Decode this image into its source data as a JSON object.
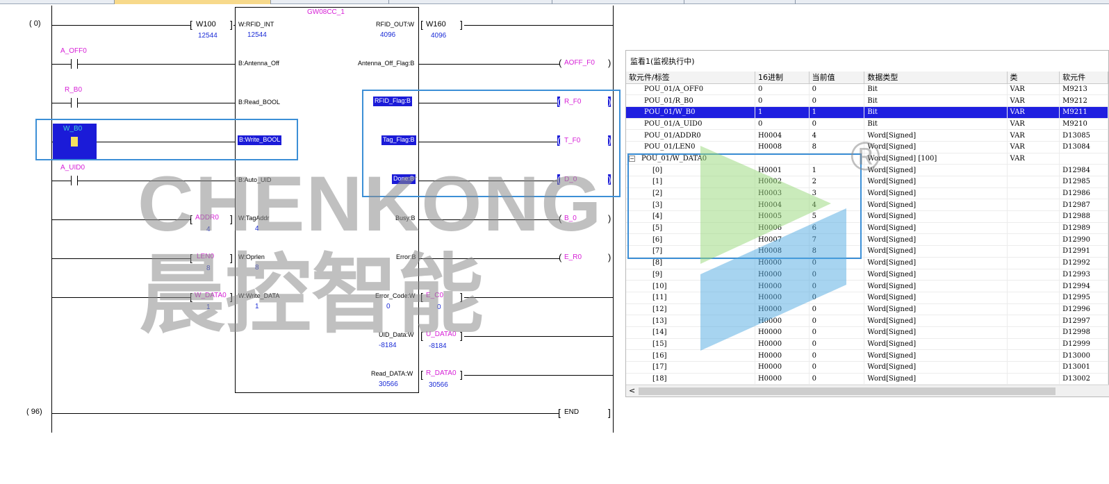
{
  "ladder": {
    "rung_numbers": [
      "( 0)",
      "( 96)"
    ],
    "fb_instance": "GW08CC_1",
    "inputs": [
      {
        "var": "W100",
        "pin": "W:RFID_INT",
        "value": "12544",
        "kind": "word"
      },
      {
        "var": "A_OFF0",
        "pin": "B:Antenna_Off",
        "kind": "bit"
      },
      {
        "var": "R_B0",
        "pin": "B:Read_BOOL",
        "kind": "bit"
      },
      {
        "var": "W_B0",
        "pin": "B:Write_BOOL",
        "kind": "bit"
      },
      {
        "var": "A_UID0",
        "pin": "B:Auto_UID",
        "kind": "bit"
      },
      {
        "var": "ADDR0",
        "pin": "W:TagAddr",
        "value": "4",
        "kind": "word"
      },
      {
        "var": "LEN0",
        "pin": "W:Oprlen",
        "value": "8",
        "kind": "word"
      },
      {
        "var": "W_DATA0",
        "pin": "W:Write_DATA",
        "value": "1",
        "kind": "word"
      }
    ],
    "outputs": [
      {
        "pin": "RFID_OUT:W",
        "var": "W160",
        "value": "4096"
      },
      {
        "pin": "Antenna_Off_Flag:B",
        "var": "AOFF_F0"
      },
      {
        "pin": "RFID_Flag:B",
        "var": "R_F0"
      },
      {
        "pin": "Tag_Flag:B",
        "var": "T_F0"
      },
      {
        "pin": "Done:B",
        "var": "D_0"
      },
      {
        "pin": "Busy:B",
        "var": "B_0"
      },
      {
        "pin": "Error:B",
        "var": "E_R0"
      },
      {
        "pin": "Error_Code:W",
        "var": "E_C0",
        "value": "0",
        "pin_value": "0"
      },
      {
        "pin": "UID_Data:W",
        "var": "U_DATA0",
        "value": "-8184",
        "pin_value": "-8184"
      },
      {
        "pin": "Read_DATA:W",
        "var": "R_DATA0",
        "value": "30566",
        "pin_value": "30566"
      }
    ],
    "end_label": "END"
  },
  "watermark": {
    "brand_en": "CHENKONG",
    "brand_cn": "晨控智能",
    "mark": "®"
  },
  "watch": {
    "title": "监看1(监视执行中)",
    "columns": [
      "软元件/标签",
      "16进制",
      "当前值",
      "数据类型",
      "类",
      "软元件"
    ],
    "rows": [
      {
        "name": "POU_01/A_OFF0",
        "hex": "0",
        "val": "0",
        "type": "Bit",
        "cls": "VAR",
        "dev": "M9213"
      },
      {
        "name": "POU_01/R_B0",
        "hex": "0",
        "val": "0",
        "type": "Bit",
        "cls": "VAR",
        "dev": "M9212"
      },
      {
        "name": "POU_01/W_B0",
        "hex": "1",
        "val": "1",
        "type": "Bit",
        "cls": "VAR",
        "dev": "M9211",
        "selected": true
      },
      {
        "name": "POU_01/A_UID0",
        "hex": "0",
        "val": "0",
        "type": "Bit",
        "cls": "VAR",
        "dev": "M9210"
      },
      {
        "name": "POU_01/ADDR0",
        "hex": "H0004",
        "val": "4",
        "type": "Word[Signed]",
        "cls": "VAR",
        "dev": "D13085"
      },
      {
        "name": "POU_01/LEN0",
        "hex": "H0008",
        "val": "8",
        "type": "Word[Signed]",
        "cls": "VAR",
        "dev": "D13084"
      },
      {
        "name": "POU_01/W_DATA0",
        "hex": "",
        "val": "",
        "type": "Word[Signed] [100]",
        "cls": "VAR",
        "dev": "",
        "expander": "−"
      },
      {
        "name": "[0]",
        "hex": "H0001",
        "val": "1",
        "type": "Word[Signed]",
        "cls": "",
        "dev": "D12984",
        "child": true
      },
      {
        "name": "[1]",
        "hex": "H0002",
        "val": "2",
        "type": "Word[Signed]",
        "cls": "",
        "dev": "D12985",
        "child": true
      },
      {
        "name": "[2]",
        "hex": "H0003",
        "val": "3",
        "type": "Word[Signed]",
        "cls": "",
        "dev": "D12986",
        "child": true
      },
      {
        "name": "[3]",
        "hex": "H0004",
        "val": "4",
        "type": "Word[Signed]",
        "cls": "",
        "dev": "D12987",
        "child": true
      },
      {
        "name": "[4]",
        "hex": "H0005",
        "val": "5",
        "type": "Word[Signed]",
        "cls": "",
        "dev": "D12988",
        "child": true
      },
      {
        "name": "[5]",
        "hex": "H0006",
        "val": "6",
        "type": "Word[Signed]",
        "cls": "",
        "dev": "D12989",
        "child": true
      },
      {
        "name": "[6]",
        "hex": "H0007",
        "val": "7",
        "type": "Word[Signed]",
        "cls": "",
        "dev": "D12990",
        "child": true
      },
      {
        "name": "[7]",
        "hex": "H0008",
        "val": "8",
        "type": "Word[Signed]",
        "cls": "",
        "dev": "D12991",
        "child": true
      },
      {
        "name": "[8]",
        "hex": "H0000",
        "val": "0",
        "type": "Word[Signed]",
        "cls": "",
        "dev": "D12992",
        "child": true
      },
      {
        "name": "[9]",
        "hex": "H0000",
        "val": "0",
        "type": "Word[Signed]",
        "cls": "",
        "dev": "D12993",
        "child": true
      },
      {
        "name": "[10]",
        "hex": "H0000",
        "val": "0",
        "type": "Word[Signed]",
        "cls": "",
        "dev": "D12994",
        "child": true
      },
      {
        "name": "[11]",
        "hex": "H0000",
        "val": "0",
        "type": "Word[Signed]",
        "cls": "",
        "dev": "D12995",
        "child": true
      },
      {
        "name": "[12]",
        "hex": "H0000",
        "val": "0",
        "type": "Word[Signed]",
        "cls": "",
        "dev": "D12996",
        "child": true
      },
      {
        "name": "[13]",
        "hex": "H0000",
        "val": "0",
        "type": "Word[Signed]",
        "cls": "",
        "dev": "D12997",
        "child": true
      },
      {
        "name": "[14]",
        "hex": "H0000",
        "val": "0",
        "type": "Word[Signed]",
        "cls": "",
        "dev": "D12998",
        "child": true
      },
      {
        "name": "[15]",
        "hex": "H0000",
        "val": "0",
        "type": "Word[Signed]",
        "cls": "",
        "dev": "D12999",
        "child": true
      },
      {
        "name": "[16]",
        "hex": "H0000",
        "val": "0",
        "type": "Word[Signed]",
        "cls": "",
        "dev": "D13000",
        "child": true
      },
      {
        "name": "[17]",
        "hex": "H0000",
        "val": "0",
        "type": "Word[Signed]",
        "cls": "",
        "dev": "D13001",
        "child": true
      },
      {
        "name": "[18]",
        "hex": "H0000",
        "val": "0",
        "type": "Word[Signed]",
        "cls": "",
        "dev": "D13002",
        "child": true
      }
    ],
    "scroll_left": "<"
  },
  "colors": {
    "variable": "#d61ed6",
    "value": "#1a2bd6",
    "selection": "#1f1fe0",
    "highlight_box": "#3c8fd6"
  }
}
